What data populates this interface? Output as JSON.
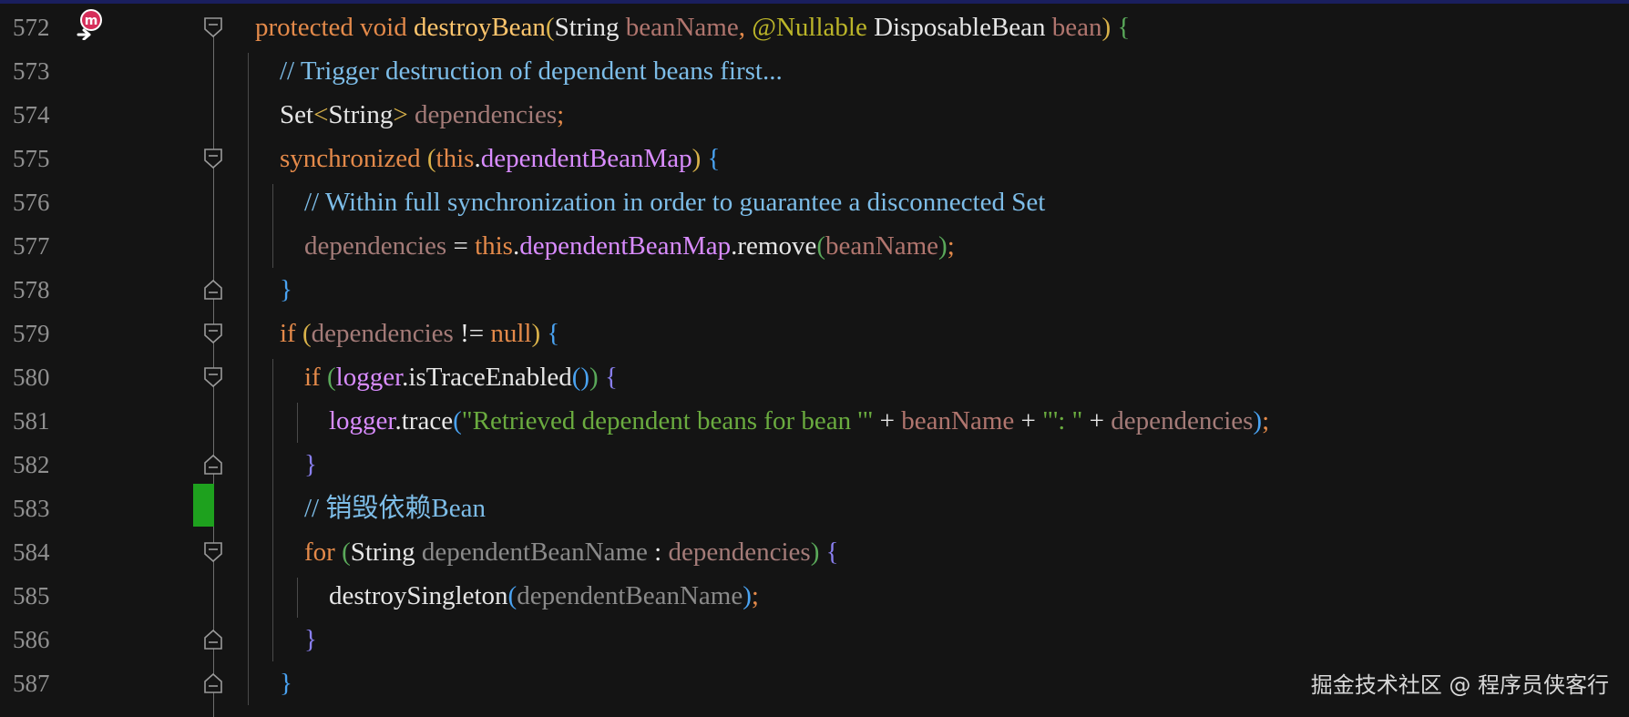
{
  "colors": {
    "background": "#141414",
    "line_number": "#8f8f8f",
    "keyword": "#e48a4a",
    "method_decl": "#ffc66d",
    "type": "#e6e6e6",
    "parameter": "#b0756e",
    "local_var": "#a47b78",
    "field": "#d98cff",
    "comment": "#7dbde8",
    "string": "#6aab3f",
    "annotation": "#bbb529",
    "paren_gold": "#d9b24a",
    "paren_green": "#5aa95a",
    "brace_blue": "#4aa3f2",
    "brace_violet": "#8a7ff0",
    "dim_var": "#8a8a8a",
    "change_marker": "#1ea11e"
  },
  "icons": {
    "gutter_method": "method-override-icon",
    "fold_open": "fold-open-icon",
    "fold_close": "fold-close-icon"
  },
  "lines": [
    {
      "num": "572",
      "indent": 0,
      "fold": "open",
      "tokens": [
        {
          "t": "protected",
          "c": "keyword"
        },
        {
          "t": " "
        },
        {
          "t": "void",
          "c": "keyword"
        },
        {
          "t": " "
        },
        {
          "t": "destroyBean",
          "c": "method_decl"
        },
        {
          "t": "(",
          "c": "paren_gold"
        },
        {
          "t": "String",
          "c": "type"
        },
        {
          "t": " "
        },
        {
          "t": "beanName",
          "c": "parameter"
        },
        {
          "t": ", ",
          "c": "keyword"
        },
        {
          "t": "@Nullable",
          "c": "annotation"
        },
        {
          "t": " "
        },
        {
          "t": "DisposableBean",
          "c": "type"
        },
        {
          "t": " "
        },
        {
          "t": "bean",
          "c": "parameter"
        },
        {
          "t": ")",
          "c": "paren_gold"
        },
        {
          "t": " "
        },
        {
          "t": "{",
          "c": "paren_green"
        }
      ]
    },
    {
      "num": "573",
      "indent": 1,
      "tokens": [
        {
          "t": "// Trigger destruction of dependent beans first...",
          "c": "comment"
        }
      ]
    },
    {
      "num": "574",
      "indent": 1,
      "tokens": [
        {
          "t": "Set",
          "c": "type"
        },
        {
          "t": "<",
          "c": "paren_gold"
        },
        {
          "t": "String",
          "c": "type"
        },
        {
          "t": ">",
          "c": "paren_gold"
        },
        {
          "t": " "
        },
        {
          "t": "dependencies",
          "c": "local_var"
        },
        {
          "t": ";",
          "c": "keyword"
        }
      ]
    },
    {
      "num": "575",
      "indent": 1,
      "fold": "open",
      "tokens": [
        {
          "t": "synchronized",
          "c": "keyword"
        },
        {
          "t": " "
        },
        {
          "t": "(",
          "c": "paren_gold"
        },
        {
          "t": "this",
          "c": "keyword"
        },
        {
          "t": ".",
          "c": "type"
        },
        {
          "t": "dependentBeanMap",
          "c": "field"
        },
        {
          "t": ")",
          "c": "paren_gold"
        },
        {
          "t": " "
        },
        {
          "t": "{",
          "c": "brace_blue"
        }
      ]
    },
    {
      "num": "576",
      "indent": 2,
      "tokens": [
        {
          "t": "// Within full synchronization in order to guarantee a disconnected Set",
          "c": "comment"
        }
      ]
    },
    {
      "num": "577",
      "indent": 2,
      "tokens": [
        {
          "t": "dependencies",
          "c": "local_var"
        },
        {
          "t": " = ",
          "c": "type"
        },
        {
          "t": "this",
          "c": "keyword"
        },
        {
          "t": ".",
          "c": "type"
        },
        {
          "t": "dependentBeanMap",
          "c": "field"
        },
        {
          "t": ".remove",
          "c": "type"
        },
        {
          "t": "(",
          "c": "paren_green"
        },
        {
          "t": "beanName",
          "c": "parameter"
        },
        {
          "t": ")",
          "c": "paren_green"
        },
        {
          "t": ";",
          "c": "keyword"
        }
      ]
    },
    {
      "num": "578",
      "indent": 1,
      "fold": "close",
      "tokens": [
        {
          "t": "}",
          "c": "brace_blue"
        }
      ]
    },
    {
      "num": "579",
      "indent": 1,
      "fold": "open",
      "tokens": [
        {
          "t": "if",
          "c": "keyword"
        },
        {
          "t": " "
        },
        {
          "t": "(",
          "c": "paren_gold"
        },
        {
          "t": "dependencies",
          "c": "local_var"
        },
        {
          "t": " != ",
          "c": "type"
        },
        {
          "t": "null",
          "c": "keyword"
        },
        {
          "t": ")",
          "c": "paren_gold"
        },
        {
          "t": " "
        },
        {
          "t": "{",
          "c": "brace_blue"
        }
      ]
    },
    {
      "num": "580",
      "indent": 2,
      "fold": "open",
      "tokens": [
        {
          "t": "if",
          "c": "keyword"
        },
        {
          "t": " "
        },
        {
          "t": "(",
          "c": "paren_green"
        },
        {
          "t": "logger",
          "c": "field"
        },
        {
          "t": ".isTraceEnabled",
          "c": "type"
        },
        {
          "t": "()",
          "c": "brace_blue"
        },
        {
          "t": ")",
          "c": "paren_green"
        },
        {
          "t": " "
        },
        {
          "t": "{",
          "c": "brace_violet"
        }
      ]
    },
    {
      "num": "581",
      "indent": 3,
      "tokens": [
        {
          "t": "logger",
          "c": "field"
        },
        {
          "t": ".trace",
          "c": "type"
        },
        {
          "t": "(",
          "c": "brace_blue"
        },
        {
          "t": "\"Retrieved dependent beans for bean '\"",
          "c": "string"
        },
        {
          "t": " + ",
          "c": "type"
        },
        {
          "t": "beanName",
          "c": "parameter"
        },
        {
          "t": " + ",
          "c": "type"
        },
        {
          "t": "\"': \"",
          "c": "string"
        },
        {
          "t": " + ",
          "c": "type"
        },
        {
          "t": "dependencies",
          "c": "local_var"
        },
        {
          "t": ")",
          "c": "brace_blue"
        },
        {
          "t": ";",
          "c": "keyword"
        }
      ]
    },
    {
      "num": "582",
      "indent": 2,
      "fold": "close",
      "tokens": [
        {
          "t": "}",
          "c": "brace_violet"
        }
      ]
    },
    {
      "num": "583",
      "indent": 2,
      "changed": true,
      "tokens": [
        {
          "t": "// 销毁依赖Bean",
          "c": "comment"
        }
      ]
    },
    {
      "num": "584",
      "indent": 2,
      "fold": "open",
      "tokens": [
        {
          "t": "for",
          "c": "keyword"
        },
        {
          "t": " "
        },
        {
          "t": "(",
          "c": "paren_green"
        },
        {
          "t": "String",
          "c": "type"
        },
        {
          "t": " "
        },
        {
          "t": "dependentBeanName",
          "c": "dim_var"
        },
        {
          "t": " : ",
          "c": "type"
        },
        {
          "t": "dependencies",
          "c": "local_var"
        },
        {
          "t": ")",
          "c": "paren_green"
        },
        {
          "t": " "
        },
        {
          "t": "{",
          "c": "brace_violet"
        }
      ]
    },
    {
      "num": "585",
      "indent": 3,
      "tokens": [
        {
          "t": "destroySingleton",
          "c": "type"
        },
        {
          "t": "(",
          "c": "brace_blue"
        },
        {
          "t": "dependentBeanName",
          "c": "dim_var"
        },
        {
          "t": ")",
          "c": "brace_blue"
        },
        {
          "t": ";",
          "c": "keyword"
        }
      ]
    },
    {
      "num": "586",
      "indent": 2,
      "fold": "close",
      "tokens": [
        {
          "t": "}",
          "c": "brace_violet"
        }
      ]
    },
    {
      "num": "587",
      "indent": 1,
      "fold": "close",
      "tokens": [
        {
          "t": "}",
          "c": "brace_blue"
        }
      ]
    }
  ],
  "watermark": "掘金技术社区 @ 程序员侠客行"
}
